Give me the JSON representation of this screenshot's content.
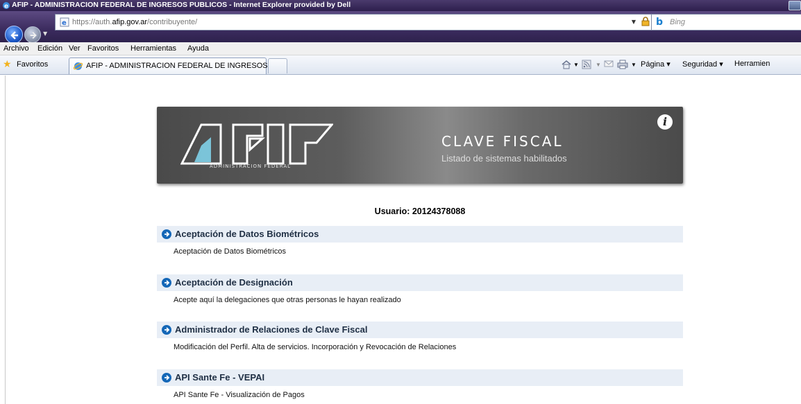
{
  "window": {
    "title": "AFIP - ADMINISTRACION FEDERAL DE INGRESOS PUBLICOS - Internet Explorer provided by Dell"
  },
  "address": {
    "url_prefix": "https://auth.",
    "url_domain": "afip.gov.ar",
    "url_path": "/contribuyente/",
    "search_placeholder": "Bing"
  },
  "menu": {
    "items": [
      "Archivo",
      "Edición",
      "Ver",
      "Favoritos",
      "Herramientas",
      "Ayuda"
    ]
  },
  "favbar": {
    "favorites_label": "Favoritos",
    "tab_label": "AFIP - ADMINISTRACION FEDERAL DE INGRESOS...",
    "commands": [
      "Página ▾",
      "Seguridad ▾",
      "Herramien"
    ]
  },
  "banner": {
    "org_name": "ADMINISTRACION FEDERAL",
    "title": "CLAVE FISCAL",
    "subtitle": "Listado de sistemas habilitados",
    "info_glyph": "i"
  },
  "user": {
    "label": "Usuario: 20124378088"
  },
  "systems": [
    {
      "name": "Aceptación de Datos Biométricos",
      "description": "Aceptación de Datos Biométricos"
    },
    {
      "name": "Aceptación de Designación",
      "description": "Acepte aquí la delegaciones que otras personas le hayan realizado"
    },
    {
      "name": "Administrador de Relaciones de Clave Fiscal",
      "description": "Modificación del Perfil. Alta de servicios. Incorporación y Revocación de Relaciones"
    },
    {
      "name": "API Sante Fe - VEPAI",
      "description": "API Sante Fe - Visualización de Pagos"
    }
  ],
  "colors": {
    "accent": "#1467b7",
    "row_header_bg": "#e8eef6",
    "banner_dark": "#4a4a4a"
  }
}
